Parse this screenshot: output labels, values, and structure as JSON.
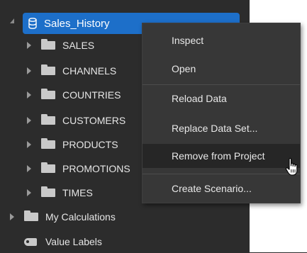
{
  "tree": {
    "root": {
      "label": "Sales_History",
      "icon": "database-icon"
    },
    "children": [
      {
        "label": "SALES",
        "icon": "folder-icon"
      },
      {
        "label": "CHANNELS",
        "icon": "folder-icon"
      },
      {
        "label": "COUNTRIES",
        "icon": "folder-icon"
      },
      {
        "label": "CUSTOMERS",
        "icon": "folder-icon"
      },
      {
        "label": "PRODUCTS",
        "icon": "folder-icon"
      },
      {
        "label": "PROMOTIONS",
        "icon": "folder-icon"
      },
      {
        "label": "TIMES",
        "icon": "folder-icon"
      }
    ],
    "my_calculations": {
      "label": "My Calculations",
      "icon": "folder-icon"
    },
    "value_labels": {
      "label": "Value Labels",
      "icon": "tag-icon"
    }
  },
  "context_menu": {
    "items": [
      {
        "label": "Inspect"
      },
      {
        "label": "Open"
      },
      {
        "label": "Reload Data"
      },
      {
        "label": "Replace Data Set..."
      },
      {
        "label": "Remove from Project",
        "hovered": true
      },
      {
        "label": "Create Scenario..."
      }
    ]
  },
  "colors": {
    "panel_bg": "#2c2c2c",
    "selection": "#1d6fc9",
    "menu_bg": "#373737",
    "menu_hover": "#262626"
  }
}
